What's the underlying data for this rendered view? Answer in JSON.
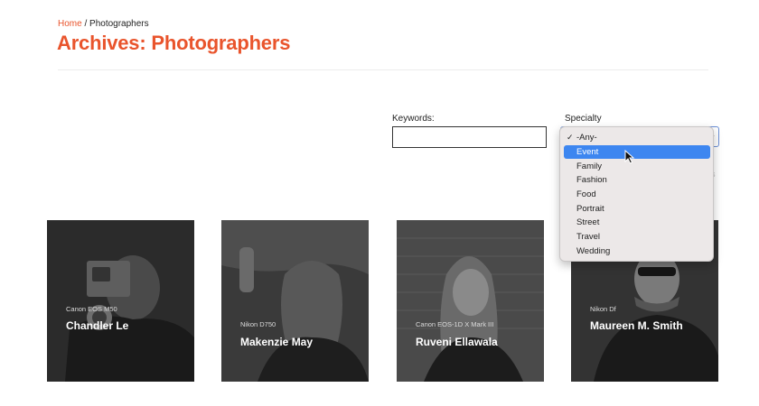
{
  "breadcrumb": {
    "home": "Home",
    "separator": "/",
    "current": "Photographers"
  },
  "page_title": "Archives: Photographers",
  "filters": {
    "keywords_label": "Keywords:",
    "keywords_value": "",
    "specialty_label": "Specialty",
    "specialty_selected": "-Any-"
  },
  "dropdown": {
    "options": [
      "-Any-",
      "Event",
      "Family",
      "Fashion",
      "Food",
      "Portrait",
      "Street",
      "Travel",
      "Wedding"
    ],
    "checked": "-Any-",
    "highlighted": "Event"
  },
  "photographers": [
    {
      "camera": "Canon EOS M50",
      "name": "Chandler Le"
    },
    {
      "camera": "Nikon D750",
      "name": "Makenzie May"
    },
    {
      "camera": "Canon EOS-1D X Mark III",
      "name": "Ruveni Ellawala"
    },
    {
      "camera": "Nikon Df",
      "name": "Maureen M. Smith"
    }
  ],
  "colors": {
    "accent": "#e9542c",
    "highlight": "#3d86f0",
    "dropdown_bg": "#ece8e8"
  },
  "icons": {
    "check": "checkmark-icon",
    "cursor": "mouse-pointer-icon",
    "select_arrow": "chevron-down-icon"
  }
}
